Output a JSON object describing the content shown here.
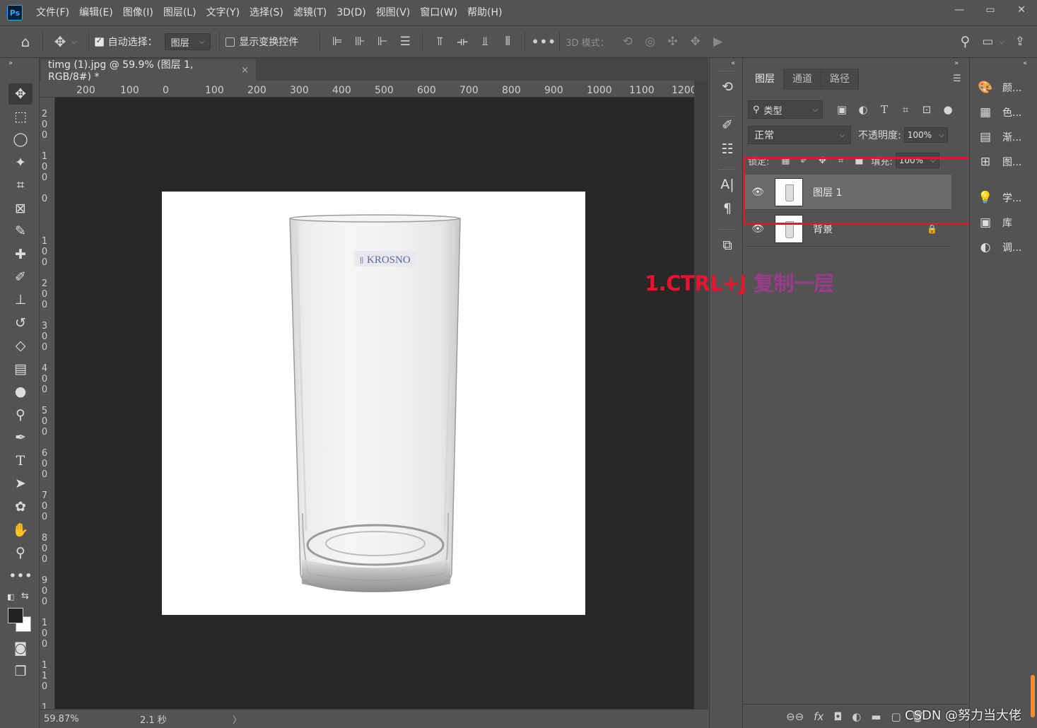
{
  "menu": [
    "文件(F)",
    "编辑(E)",
    "图像(I)",
    "图层(L)",
    "文字(Y)",
    "选择(S)",
    "滤镜(T)",
    "3D(D)",
    "视图(V)",
    "窗口(W)",
    "帮助(H)"
  ],
  "app_logo": "Ps",
  "window_controls": {
    "minimize": "—",
    "maximize": "▭",
    "close": "✕"
  },
  "options": {
    "auto_select_label": "自动选择：",
    "auto_select_checked": true,
    "auto_select_target": "图层",
    "show_transform_label": "显示变换控件",
    "show_transform_checked": false,
    "mode_3d_label": "3D 模式："
  },
  "document": {
    "tab_title": "timg (1).jpg @ 59.9% (图层 1, RGB/8#) *",
    "close_glyph": "×"
  },
  "ruler_top": [
    "200",
    "100",
    "0",
    "100",
    "200",
    "300",
    "400",
    "500",
    "600",
    "700",
    "800",
    "900",
    "1000",
    "1100",
    "1200"
  ],
  "ruler_left": [
    "2\n0\n0",
    "1\n0\n0",
    "0",
    "1\n0\n0",
    "2\n0\n0",
    "3\n0\n0",
    "4\n0\n0",
    "5\n0\n0",
    "6\n0\n0",
    "7\n0\n0",
    "8\n0\n0",
    "9\n0\n0",
    "1\n0\n0",
    "1\n1\n0",
    "1"
  ],
  "image": {
    "brand_text": "KROSNO",
    "brand_mark": "||"
  },
  "status": {
    "zoom": "59.87%",
    "time": "2.1 秒",
    "arrow": "〉"
  },
  "layers_panel": {
    "tabs": [
      "图层",
      "通道",
      "路径"
    ],
    "active_tab": 0,
    "filter_kind": "类型",
    "blend_mode": "正常",
    "opacity_label": "不透明度:",
    "opacity_value": "100%",
    "lock_label": "锁定:",
    "fill_label": "填充:",
    "fill_value": "100%",
    "layers": [
      {
        "name": "图层 1",
        "visible": true,
        "selected": true,
        "locked": false
      },
      {
        "name": "背景",
        "visible": true,
        "selected": false,
        "locked": true
      }
    ],
    "bottom_icons": [
      "⊖⊖",
      "fx",
      "◘",
      "◐",
      "▬",
      "▢",
      "🗑"
    ]
  },
  "right_dock": [
    "颜...",
    "色...",
    "渐...",
    "图...",
    "学...",
    "库",
    "调..."
  ],
  "annotation": {
    "part1": "1.CTRL+J",
    "part2": "复制一层"
  },
  "watermark": "CSDN @努力当大佬",
  "colors": {
    "panel": "#535353",
    "canvas_bg": "#282828",
    "highlight_red": "#e8142e",
    "annotation_purple": "#9b3b8c",
    "selected_row": "#6a6a6a"
  }
}
